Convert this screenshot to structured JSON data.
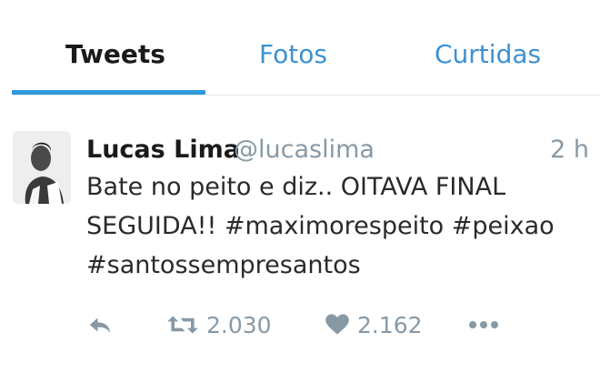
{
  "tabs": [
    {
      "label": "Tweets"
    },
    {
      "label": "Fotos"
    },
    {
      "label": "Curtidas"
    }
  ],
  "tweet": {
    "author_name": "Lucas Lima",
    "handle": "@lucaslima",
    "time": "2 h",
    "text_line1": "Bate no peito e diz.. OITAVA FINAL",
    "text_line2": "SEGUIDA!! #maximorespeito #peixao",
    "text_line3": "#santossempresantos",
    "retweet_count": "2.030",
    "like_count": "2.162"
  },
  "icons": {
    "reply": "reply-icon",
    "retweet": "retweet-icon",
    "like": "heart-icon",
    "more": "more-icon"
  },
  "colors": {
    "accent": "#2f9ae0",
    "tab_inactive": "#3d91d0",
    "muted": "#8899a6"
  }
}
